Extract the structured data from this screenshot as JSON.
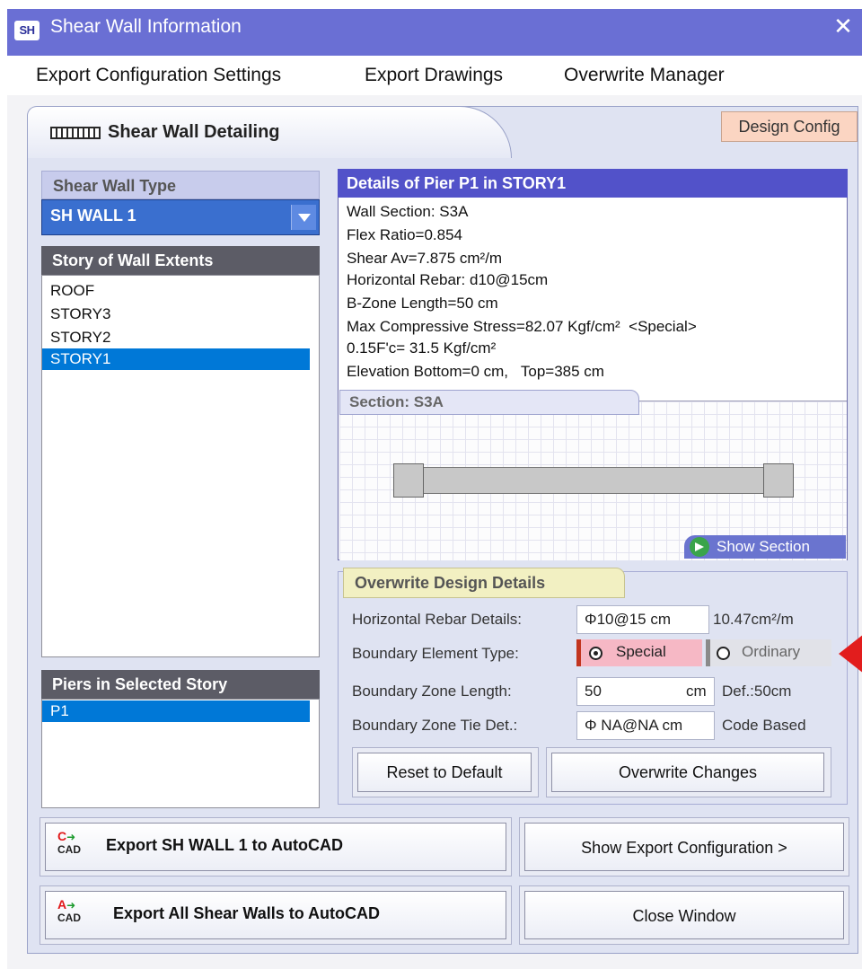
{
  "window": {
    "app_badge": "SH",
    "title": "Shear Wall Information",
    "close_glyph": "✕"
  },
  "menu": {
    "items": [
      "Export Configuration Settings",
      "Export Drawings",
      "Overwrite Manager"
    ]
  },
  "header": {
    "title": "Shear Wall Detailing",
    "design_config": "Design Config"
  },
  "wall_type": {
    "label": "Shear Wall Type",
    "selected": "SH WALL 1"
  },
  "stories": {
    "label": "Story of Wall Extents",
    "items": [
      "ROOF",
      "STORY3",
      "STORY2",
      "STORY1"
    ],
    "selected_index": 3
  },
  "piers": {
    "label": "Piers in Selected Story",
    "items": [
      "P1"
    ],
    "selected_index": 0
  },
  "details": {
    "header": "Details of Pier P1 in STORY1",
    "lines": [
      "Wall Section: S3A",
      "Flex Ratio=0.854",
      "Shear Av=7.875 cm²/m",
      "Horizontal Rebar: d10@15cm",
      "B-Zone Length=50 cm",
      "Max Compressive Stress=82.07 Kgf/cm²  <Special>",
      "0.15F'c= 31.5 Kgf/cm²",
      "Elevation Bottom=0 cm,   Top=385 cm"
    ],
    "section_tab": "Section: S3A",
    "show_section": "Show Section"
  },
  "overwrite": {
    "title": "Overwrite Design Details",
    "horizontal_rebar": {
      "label": "Horizontal Rebar Details:",
      "value": "Φ10@15  cm",
      "note": "10.47cm²/m"
    },
    "boundary_type": {
      "label": "Boundary Element Type:",
      "option_special": "Special",
      "option_ordinary": "Ordinary",
      "selected": "Special"
    },
    "zone_length": {
      "label": "Boundary  Zone Length:",
      "value": "50",
      "unit": "cm",
      "note": "Def.:50cm"
    },
    "zone_tie": {
      "label": "Boundary Zone Tie Det.:",
      "value": "Φ NA@NA cm",
      "note": "Code Based"
    },
    "reset_button": "Reset to Default",
    "overwrite_button": "Overwrite Changes"
  },
  "actions": {
    "export_one_icon_top": "C",
    "export_all_icon_top": "A",
    "icon_bottom": "CAD",
    "export_one": "Export  SH WALL 1  to AutoCAD",
    "export_all": "Export All Shear Walls to AutoCAD",
    "show_config": "Show Export Configuration >",
    "close_window": "Close Window"
  },
  "colors": {
    "title_bar": "#6a6fd4",
    "selection": "#0078d7",
    "details_header": "#5252c9",
    "special_option": "#f6b8c5",
    "pointer_arrow": "#e21d1d"
  }
}
